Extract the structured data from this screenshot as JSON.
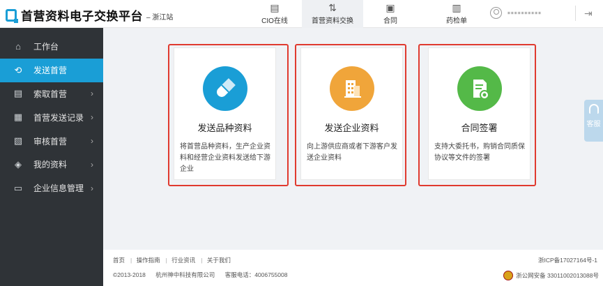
{
  "header": {
    "title": "首营资料电子交换平台",
    "subtitle": "– 浙江站",
    "nav": [
      {
        "label": "CIO在线",
        "icon": "document-list-icon"
      },
      {
        "label": "首营资料交换",
        "icon": "exchange-arrows-icon"
      },
      {
        "label": "合同",
        "icon": "contract-icon"
      },
      {
        "label": "药检单",
        "icon": "report-icon"
      }
    ],
    "user_name": "▪▪▪▪▪▪▪▪▪▪",
    "logout_icon": "logout-icon"
  },
  "sidebar": {
    "items": [
      {
        "label": "工作台",
        "icon": "home-icon",
        "arrow": ""
      },
      {
        "label": "发送首营",
        "icon": "send-loop-icon",
        "arrow": ""
      },
      {
        "label": "索取首营",
        "icon": "request-doc-icon",
        "arrow": "›"
      },
      {
        "label": "首营发送记录",
        "icon": "clipboard-icon",
        "arrow": "›"
      },
      {
        "label": "审核首营",
        "icon": "review-icon",
        "arrow": "›"
      },
      {
        "label": "我的资料",
        "icon": "layers-icon",
        "arrow": "›"
      },
      {
        "label": "企业信息管理",
        "icon": "building-icon",
        "arrow": "›"
      }
    ]
  },
  "cards": [
    {
      "title": "发送品种资料",
      "desc": "将首营品种资料，生产企业资料和经营企业资料发送给下游企业",
      "color": "#1a9ed6",
      "icon": "pill-icon"
    },
    {
      "title": "发送企业资料",
      "desc": "向上游供应商或者下游客户发送企业资料",
      "color": "#f0a53a",
      "icon": "building-icon"
    },
    {
      "title": "合同签署",
      "desc": "支持大委托书，购销合同质保协议等文件的签署",
      "color": "#54b948",
      "icon": "contract-seal-icon"
    }
  ],
  "footer": {
    "links": [
      "首页",
      "操作指南",
      "行业资讯",
      "关于我们"
    ],
    "copyright": "©2013-2018",
    "company": "杭州神中科技有限公司",
    "phone": "客服电话：4006755008",
    "icp": "浙ICP备17027164号-1",
    "police": "浙公网安备 33011002013088号"
  },
  "kefu": {
    "label": "客服"
  }
}
